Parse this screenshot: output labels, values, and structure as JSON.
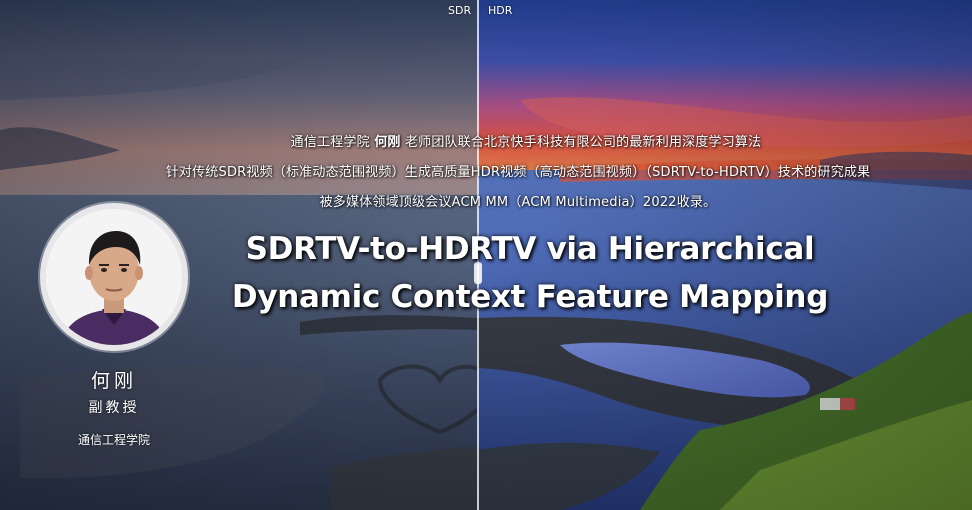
{
  "compare": {
    "left_label": "SDR",
    "right_label": "HDR"
  },
  "intro": {
    "line1_pre": "通信工程学院 ",
    "line1_name": "何刚",
    "line1_post": " 老师团队联合北京快手科技有限公司的最新利用深度学习算法",
    "line2": "针对传统SDR视频（标准动态范围视频）生成高质量HDR视频（高动态范围视频）（SDRTV-to-HDRTV）技术的研究成果",
    "line3": "被多媒体领域顶级会议ACM MM（ACM Multimedia）2022收录。"
  },
  "title": {
    "line1": "SDRTV-to-HDRTV via Hierarchical",
    "line2": "Dynamic Context Feature Mapping"
  },
  "person": {
    "name": "何刚",
    "rank": "副教授",
    "school": "通信工程学院"
  }
}
